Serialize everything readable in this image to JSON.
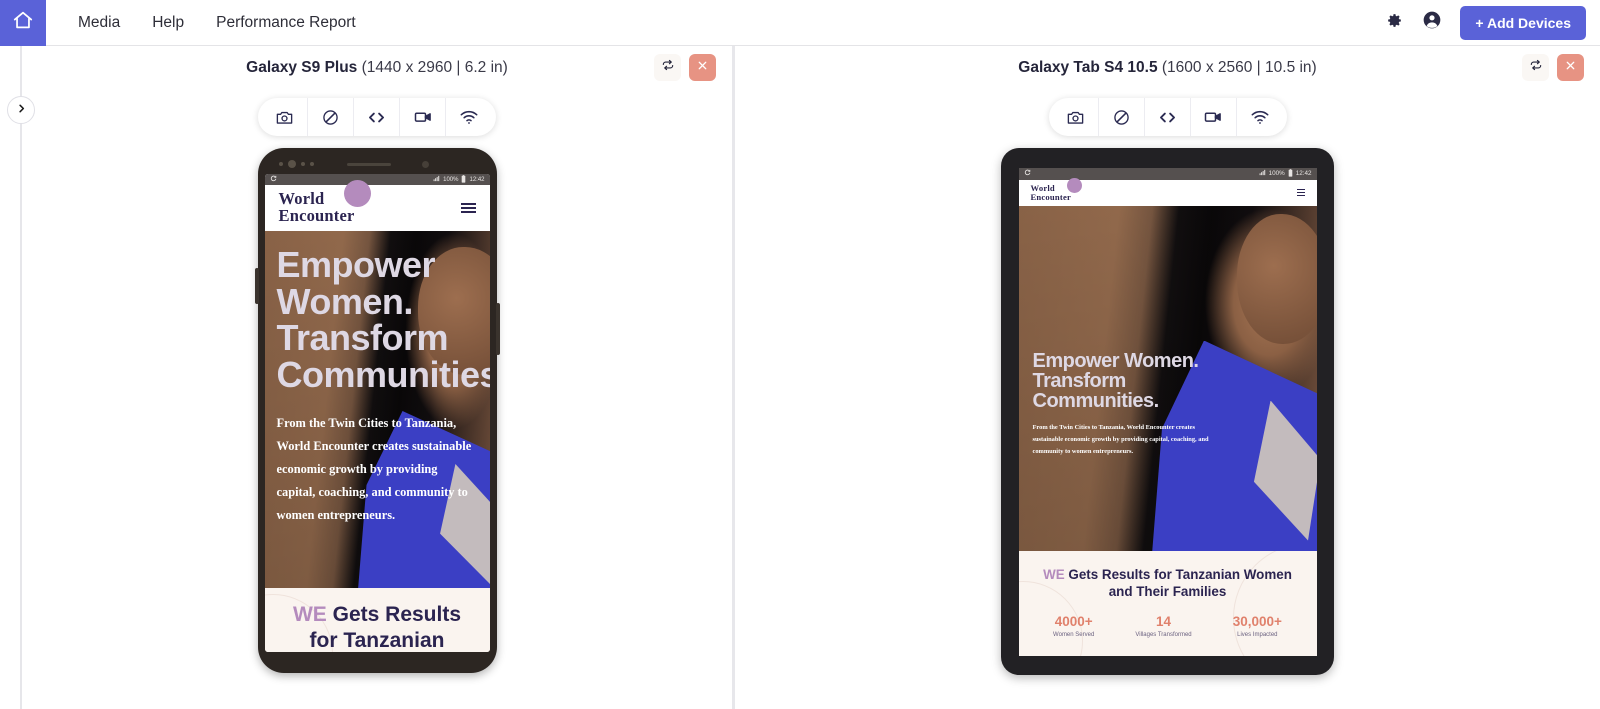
{
  "topnav": {
    "home_icon": "home-icon",
    "links": [
      {
        "label": "Media"
      },
      {
        "label": "Help"
      },
      {
        "label": "Performance Report"
      }
    ],
    "settings_icon": "gear-icon",
    "account_icon": "account-circle-icon",
    "add_devices_label": "+ Add Devices",
    "accent_color": "#5a62d8"
  },
  "sidebar": {
    "toggle_icon": "chevron-right-icon"
  },
  "toolbar_tools": [
    {
      "name": "screenshot-icon"
    },
    {
      "name": "rotate-lock-icon"
    },
    {
      "name": "inspect-code-icon"
    },
    {
      "name": "record-video-icon"
    },
    {
      "name": "network-throttle-icon"
    }
  ],
  "devices": [
    {
      "name": "Galaxy S9 Plus",
      "spec": "(1440 x 2960 | 6.2 in)",
      "rotate_icon": "rotate-icon",
      "close_icon": "close-icon",
      "close_color": "#e79383",
      "status_bar": {
        "left_icon": "sync-icon",
        "signal": "signal-icon",
        "battery_pct": "100%",
        "battery_icon": "battery-icon",
        "time": "12:42"
      },
      "site": {
        "logo_line1": "World",
        "logo_line2": "Encounter",
        "menu_icon": "hamburger-menu-icon",
        "hero_title": "Empower Women. Transform Communities.",
        "hero_sub": "From the Twin Cities to Tanzania, World Encounter creates sustainable economic growth by providing capital, coaching, and community to women entrepreneurs.",
        "stats_title_accent": "WE",
        "stats_title_rest": " Gets Results for Tanzanian Women and Their Families",
        "stats": []
      }
    },
    {
      "name": "Galaxy Tab S4 10.5",
      "spec": "(1600 x 2560 | 10.5 in)",
      "rotate_icon": "rotate-icon",
      "close_icon": "close-icon",
      "close_color": "#e79383",
      "status_bar": {
        "left_icon": "sync-icon",
        "signal": "signal-icon",
        "battery_pct": "100%",
        "battery_icon": "battery-icon",
        "time": "12:42"
      },
      "site": {
        "logo_line1": "World",
        "logo_line2": "Encounter",
        "menu_icon": "hamburger-menu-icon",
        "hero_title": "Empower Women. Transform Communities.",
        "hero_sub": "From the Twin Cities to Tanzania, World Encounter creates sustainable economic growth by providing capital, coaching, and community to women entrepreneurs.",
        "stats_title_accent": "WE",
        "stats_title_rest": " Gets Results for Tanzanian Women and Their Families",
        "stats": [
          {
            "value": "4000+",
            "label": "Women Served"
          },
          {
            "value": "14",
            "label": "Villages Transformed"
          },
          {
            "value": "30,000+",
            "label": "Lives Impacted"
          }
        ]
      }
    }
  ]
}
